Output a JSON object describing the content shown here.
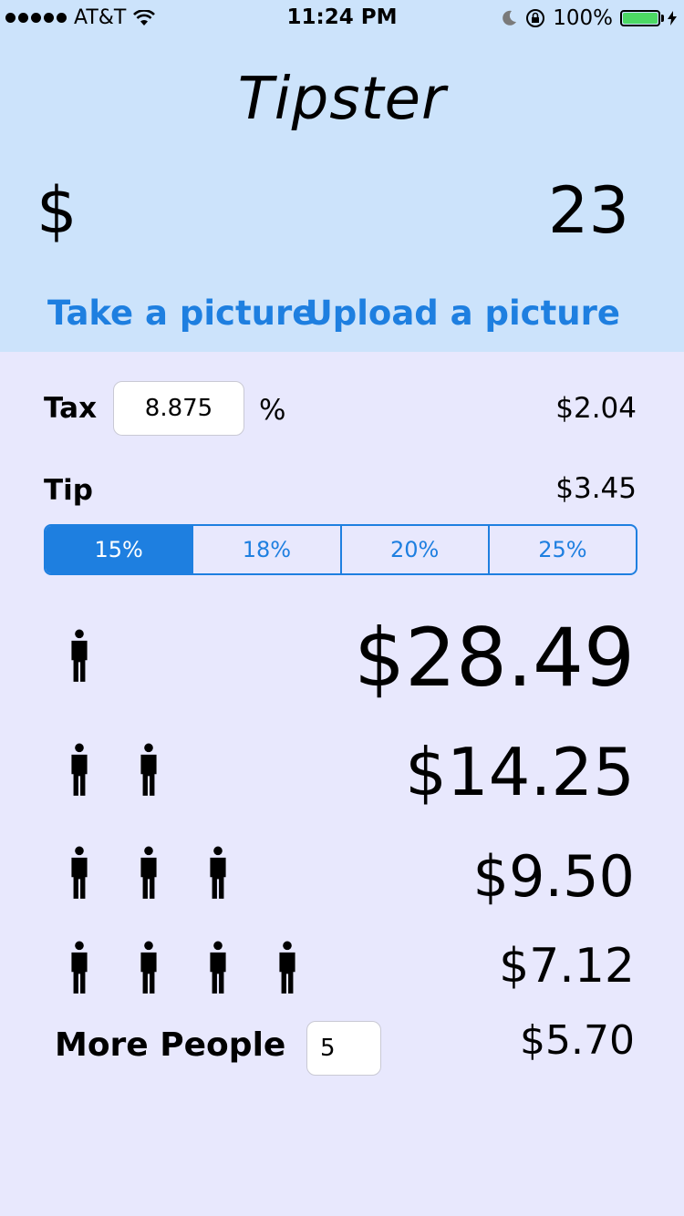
{
  "status_bar": {
    "carrier": "AT&T",
    "time": "11:24 PM",
    "battery": "100%"
  },
  "app": {
    "title": "Tipster",
    "currency_symbol": "$",
    "bill_amount": "23",
    "take_picture_label": "Take a picture",
    "upload_picture_label": "Upload a picture"
  },
  "tax": {
    "label": "Tax",
    "rate_value": "8.875",
    "percent_symbol": "%",
    "amount": "$2.04"
  },
  "tip": {
    "label": "Tip",
    "amount": "$3.45",
    "options": [
      "15%",
      "18%",
      "20%",
      "25%"
    ],
    "selected": "15%"
  },
  "split": [
    {
      "people": 1,
      "amount": "$28.49"
    },
    {
      "people": 2,
      "amount": "$14.25"
    },
    {
      "people": 3,
      "amount": "$9.50"
    },
    {
      "people": 4,
      "amount": "$7.12"
    }
  ],
  "more_people": {
    "label": "More People",
    "count_value": "5",
    "amount": "$5.70"
  },
  "colors": {
    "header_bg": "#cce3fb",
    "body_bg": "#e8e8fd",
    "accent": "#1e7fe0",
    "battery": "#4cd964"
  }
}
